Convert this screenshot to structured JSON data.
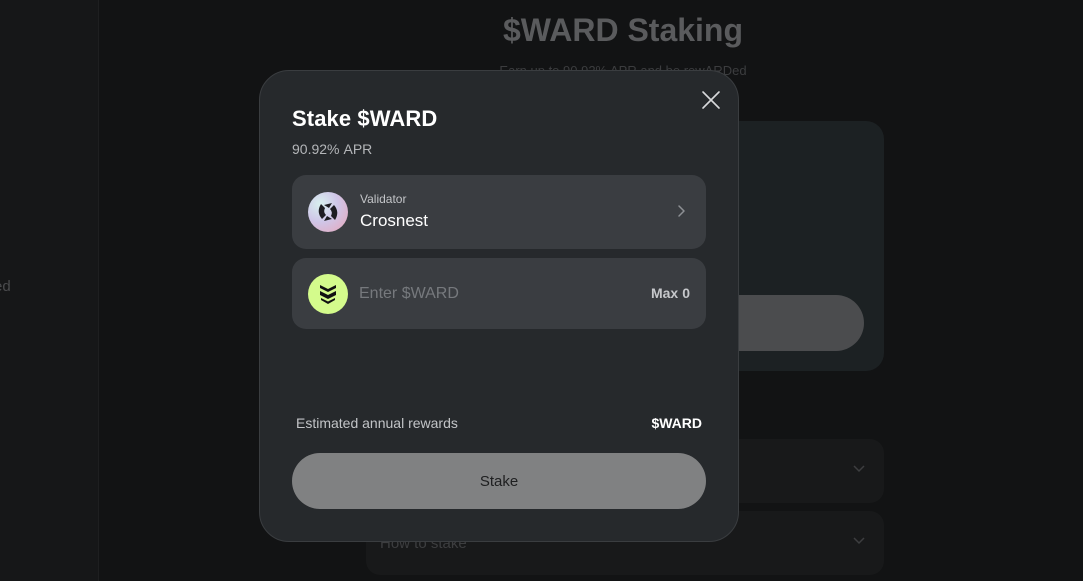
{
  "background": {
    "sidebar_text": "ed",
    "title": "$WARD Staking",
    "subtitle": "Earn up to 90.92% APR and be rewARDed",
    "accordion": [
      {
        "label": ""
      },
      {
        "label": "How to stake"
      }
    ]
  },
  "modal": {
    "title": "Stake $WARD",
    "apr_value": "90.92%",
    "apr_unit": "APR",
    "close_icon": "close-icon",
    "validator": {
      "caption": "Validator",
      "name": "Crosnest",
      "icon": "validator-logo-icon",
      "chevron_icon": "chevron-right-icon"
    },
    "amount": {
      "placeholder": "Enter $WARD",
      "value": "",
      "token_icon": "ward-token-icon",
      "max_label": "Max",
      "max_value": "0"
    },
    "rewards": {
      "label": "Estimated annual rewards",
      "value": "$WARD"
    },
    "stake_button": "Stake"
  },
  "colors": {
    "modal_bg": "#26292c",
    "field_bg": "#3a3d41",
    "token_accent": "#d4fb8c",
    "button_disabled": "#808182"
  }
}
